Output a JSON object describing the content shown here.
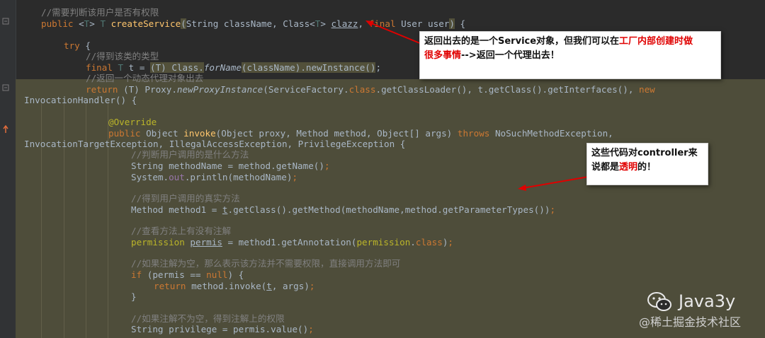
{
  "code_lines": [
    {
      "segments": [
        {
          "t": "//需要判断该用户是否有权限",
          "c": "cm"
        }
      ]
    },
    {
      "segments": [
        {
          "t": "public ",
          "c": "kw"
        },
        {
          "t": "<",
          "c": ""
        },
        {
          "t": "T",
          "c": "ty"
        },
        {
          "t": "> ",
          "c": ""
        },
        {
          "t": "T ",
          "c": "ty"
        },
        {
          "t": "createService",
          "c": "fn"
        },
        {
          "t": "(",
          "c": "hlb"
        },
        {
          "t": "String className, Class<",
          "c": ""
        },
        {
          "t": "T",
          "c": "ty"
        },
        {
          "t": "> ",
          "c": ""
        },
        {
          "t": "clazz",
          "c": "pm"
        },
        {
          "t": ", ",
          "c": ""
        },
        {
          "t": "final ",
          "c": "kw"
        },
        {
          "t": "User user",
          "c": ""
        },
        {
          "t": ")",
          "c": "hlb"
        },
        {
          "t": " {",
          "c": ""
        }
      ]
    },
    {
      "segments": [
        {
          "t": "try ",
          "c": "kw"
        },
        {
          "t": "{",
          "c": ""
        }
      ]
    },
    {
      "segments": [
        {
          "t": "//得到该类的类型",
          "c": "cm"
        }
      ]
    },
    {
      "segments": [
        {
          "t": "final ",
          "c": "kw"
        },
        {
          "t": "T ",
          "c": "ty"
        },
        {
          "t": "t = ",
          "c": ""
        },
        {
          "t": "(T) Class.",
          "c": "hlb"
        },
        {
          "t": "forName",
          "c": "it"
        },
        {
          "t": "(className).newInstance()",
          "c": "hlb"
        },
        {
          "t": ";",
          "c": ""
        }
      ]
    },
    {
      "segments": [
        {
          "t": "//返回一个动态代理对象出去",
          "c": "cm"
        }
      ]
    },
    {
      "segments": [
        {
          "t": "return ",
          "c": "kw"
        },
        {
          "t": "(T) Proxy.",
          "c": ""
        },
        {
          "t": "newProxyInstance",
          "c": "it"
        },
        {
          "t": "(ServiceFactory.",
          "c": ""
        },
        {
          "t": "class",
          "c": "kw"
        },
        {
          "t": ".getClassLoader(), t.getClass().getInterfaces(), ",
          "c": ""
        },
        {
          "t": "new",
          "c": "kw"
        }
      ]
    },
    {
      "segments": [
        {
          "t": "InvocationHandler() {",
          "c": ""
        }
      ]
    },
    {
      "segments": [
        {
          "t": "@Override",
          "c": "an"
        }
      ]
    },
    {
      "segments": [
        {
          "t": "public ",
          "c": "kw"
        },
        {
          "t": "Object ",
          "c": ""
        },
        {
          "t": "invoke",
          "c": "fn"
        },
        {
          "t": "(Object proxy, Method method, Object[] args) ",
          "c": ""
        },
        {
          "t": "throws ",
          "c": "kw"
        },
        {
          "t": "NoSuchMethodException,",
          "c": ""
        }
      ]
    },
    {
      "segments": [
        {
          "t": "InvocationTargetException, IllegalAccessException, PrivilegeException {",
          "c": ""
        }
      ]
    },
    {
      "segments": [
        {
          "t": "//判断用户调用的是什么方法",
          "c": "cm"
        }
      ]
    },
    {
      "segments": [
        {
          "t": "String methodName = method.getName()",
          "c": ""
        },
        {
          "t": ";",
          "c": "kw"
        }
      ]
    },
    {
      "segments": [
        {
          "t": "System.",
          "c": ""
        },
        {
          "t": "out",
          "c": "fd"
        },
        {
          "t": ".println(methodName)",
          "c": ""
        },
        {
          "t": ";",
          "c": "kw"
        }
      ]
    },
    {
      "segments": [
        {
          "t": "//得到用户调用的真实方法",
          "c": "cm"
        }
      ]
    },
    {
      "segments": [
        {
          "t": "Method method1 = ",
          "c": ""
        },
        {
          "t": "t",
          "c": "pm"
        },
        {
          "t": ".getClass().getMethod(methodName,method.getParameterTypes())",
          "c": ""
        },
        {
          "t": ";",
          "c": "kw"
        }
      ]
    },
    {
      "segments": [
        {
          "t": "//查看方法上有没有注解",
          "c": "cm"
        }
      ]
    },
    {
      "segments": [
        {
          "t": "permission ",
          "c": "an"
        },
        {
          "t": "permis",
          "c": "pm"
        },
        {
          "t": " = method1.getAnnotation(",
          "c": ""
        },
        {
          "t": "permission",
          "c": "an"
        },
        {
          "t": ".",
          "c": ""
        },
        {
          "t": "class",
          "c": "kw"
        },
        {
          "t": ")",
          "c": ""
        },
        {
          "t": ";",
          "c": "kw"
        }
      ]
    },
    {
      "segments": [
        {
          "t": "//如果注解为空，那么表示该方法并不需要权限，直接调用方法即可",
          "c": "cm"
        }
      ]
    },
    {
      "segments": [
        {
          "t": "if ",
          "c": "kw"
        },
        {
          "t": "(permis == ",
          "c": ""
        },
        {
          "t": "null",
          "c": "kw"
        },
        {
          "t": ") {",
          "c": ""
        }
      ]
    },
    {
      "segments": [
        {
          "t": "return ",
          "c": "kw"
        },
        {
          "t": "method.invoke(",
          "c": ""
        },
        {
          "t": "t",
          "c": "pm"
        },
        {
          "t": ", args)",
          "c": ""
        },
        {
          "t": ";",
          "c": "kw"
        }
      ]
    },
    {
      "segments": [
        {
          "t": "}",
          "c": ""
        }
      ]
    },
    {
      "segments": [
        {
          "t": "//如果注解不为空，得到注解上的权限",
          "c": "cm"
        }
      ]
    },
    {
      "segments": [
        {
          "t": "String privilege = permis.value()",
          "c": ""
        },
        {
          "t": ";",
          "c": "kw"
        }
      ]
    }
  ],
  "callouts": {
    "service": {
      "line1_a": "返回出去的是一个Service对象，但我们可以在",
      "line1_red": "工厂内部创建时做",
      "line2_red": "很多事情",
      "line2_b": "-->返回一个代理出去！"
    },
    "controller": {
      "line1": "这些代码对controller来",
      "line2_a": "说都是",
      "line2_red": "透明",
      "line2_b": "的！"
    }
  },
  "watermark": {
    "brand": "Java3y",
    "site": "@稀土掘金技术社区"
  },
  "colors": {
    "background": "#2b2b2b",
    "highlight_block": "#4e4d3a",
    "keyword": "#cc7832",
    "comment": "#808080",
    "method": "#ffc66d",
    "annotation": "#bbb529",
    "arrow": "#e00000",
    "callout_red": "#e00000"
  }
}
